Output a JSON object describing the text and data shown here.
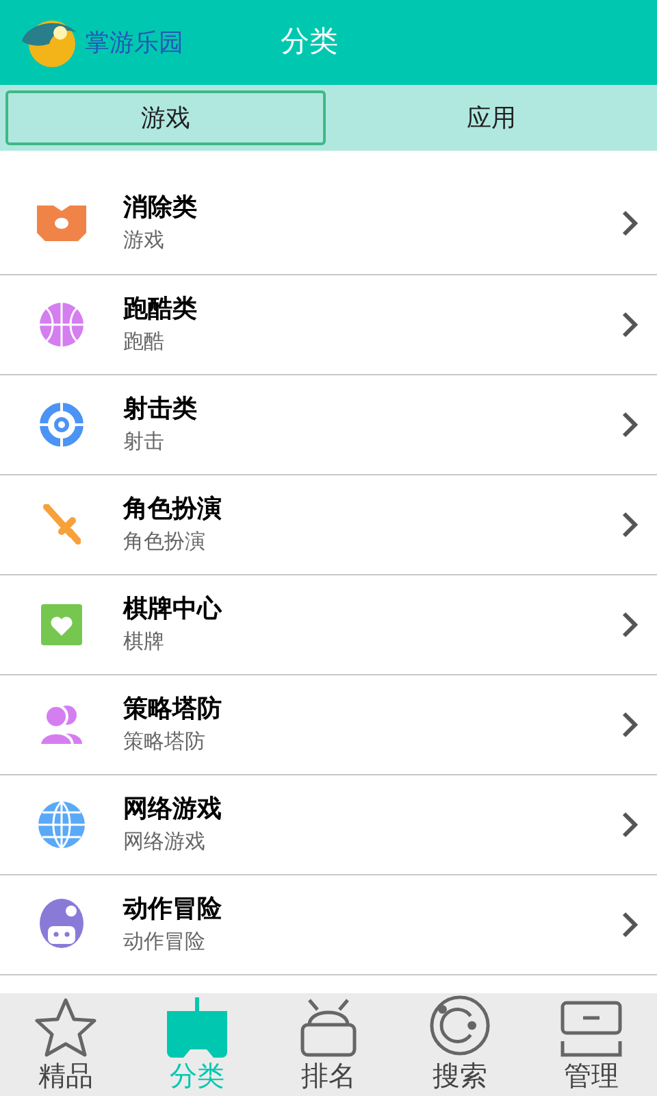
{
  "header": {
    "logo_text": "掌游乐园",
    "title": "分类"
  },
  "tabs": [
    {
      "label": "游戏",
      "selected": true
    },
    {
      "label": "应用",
      "selected": false
    }
  ],
  "categories": [
    {
      "title": "消除类",
      "subtitle": "游戏"
    },
    {
      "title": "跑酷类",
      "subtitle": "跑酷"
    },
    {
      "title": "射击类",
      "subtitle": "射击"
    },
    {
      "title": "角色扮演",
      "subtitle": "角色扮演"
    },
    {
      "title": "棋牌中心",
      "subtitle": "棋牌"
    },
    {
      "title": "策略塔防",
      "subtitle": "策略塔防"
    },
    {
      "title": "网络游戏",
      "subtitle": "网络游戏"
    },
    {
      "title": "动作冒险",
      "subtitle": "动作冒险"
    }
  ],
  "bottom_nav": [
    {
      "label": "精品",
      "selected": false
    },
    {
      "label": "分类",
      "selected": true
    },
    {
      "label": "排名",
      "selected": false
    },
    {
      "label": "搜索",
      "selected": false
    },
    {
      "label": "管理",
      "selected": false
    }
  ]
}
